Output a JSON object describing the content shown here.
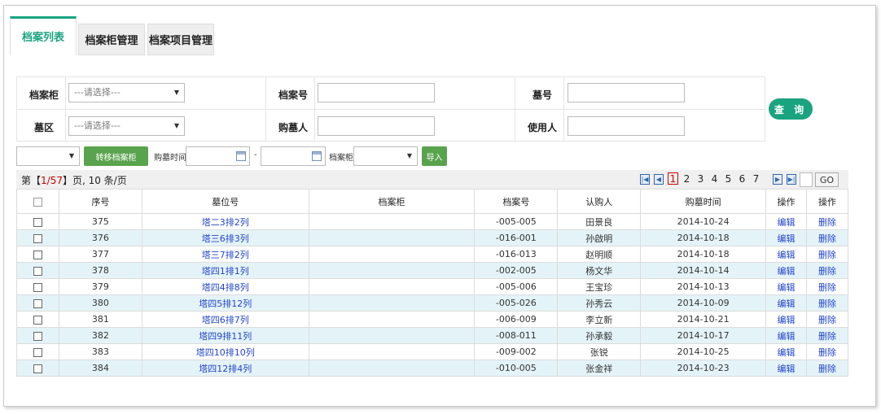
{
  "tabs": [
    "档案列表",
    "档案柜管理",
    "档案项目管理"
  ],
  "search": {
    "cabinet_label": "档案柜",
    "cabinet_value": "---请选择---",
    "area_label": "墓区",
    "area_value": "---请选择---",
    "archive_no_label": "档案号",
    "buyer_label": "购墓人",
    "grave_no_label": "墓号",
    "user_label": "使用人",
    "query_label": "查 询"
  },
  "toolbar": {
    "move_label": "转移档案柜",
    "purchase_time_label": "购墓时间",
    "dash": "-",
    "cabinet_label": "档案柜",
    "import_label": "导入"
  },
  "pager": {
    "prefix": "第【",
    "current": "1/57",
    "suffix": "】页, 10 条/页",
    "pages": [
      "1",
      "2",
      "3",
      "4",
      "5",
      "6",
      "7"
    ],
    "go_label": "GO"
  },
  "table": {
    "headers": [
      "序号",
      "墓位号",
      "档案柜",
      "档案号",
      "认购人",
      "购墓时间",
      "操作",
      "操作"
    ],
    "rows": [
      {
        "id": "375",
        "grave": "塔二3排2列",
        "cabinet": "",
        "archive": "-005-005",
        "buyer": "田景良",
        "date": "2014-10-24",
        "edit": "编辑",
        "del": "删除"
      },
      {
        "id": "376",
        "grave": "塔三6排3列",
        "cabinet": "",
        "archive": "-016-001",
        "buyer": "孙啟明",
        "date": "2014-10-18",
        "edit": "编辑",
        "del": "删除"
      },
      {
        "id": "377",
        "grave": "塔三7排2列",
        "cabinet": "",
        "archive": "-016-013",
        "buyer": "赵明顺",
        "date": "2014-10-18",
        "edit": "编辑",
        "del": "删除"
      },
      {
        "id": "378",
        "grave": "塔四1排1列",
        "cabinet": "",
        "archive": "-002-005",
        "buyer": "杨文华",
        "date": "2014-10-14",
        "edit": "编辑",
        "del": "删除"
      },
      {
        "id": "379",
        "grave": "塔四4排8列",
        "cabinet": "",
        "archive": "-005-006",
        "buyer": "王宝珍",
        "date": "2014-10-13",
        "edit": "编辑",
        "del": "删除"
      },
      {
        "id": "380",
        "grave": "塔四5排12列",
        "cabinet": "",
        "archive": "-005-026",
        "buyer": "孙秀云",
        "date": "2014-10-09",
        "edit": "编辑",
        "del": "删除"
      },
      {
        "id": "381",
        "grave": "塔四6排7列",
        "cabinet": "",
        "archive": "-006-009",
        "buyer": "李立新",
        "date": "2014-10-21",
        "edit": "编辑",
        "del": "删除"
      },
      {
        "id": "382",
        "grave": "塔四9排11列",
        "cabinet": "",
        "archive": "-008-011",
        "buyer": "孙承毅",
        "date": "2014-10-17",
        "edit": "编辑",
        "del": "删除"
      },
      {
        "id": "383",
        "grave": "塔四10排10列",
        "cabinet": "",
        "archive": "-009-002",
        "buyer": "张锐",
        "date": "2014-10-25",
        "edit": "编辑",
        "del": "删除"
      },
      {
        "id": "384",
        "grave": "塔四12排4列",
        "cabinet": "",
        "archive": "-010-005",
        "buyer": "张金祥",
        "date": "2014-10-23",
        "edit": "编辑",
        "del": "删除"
      }
    ]
  }
}
